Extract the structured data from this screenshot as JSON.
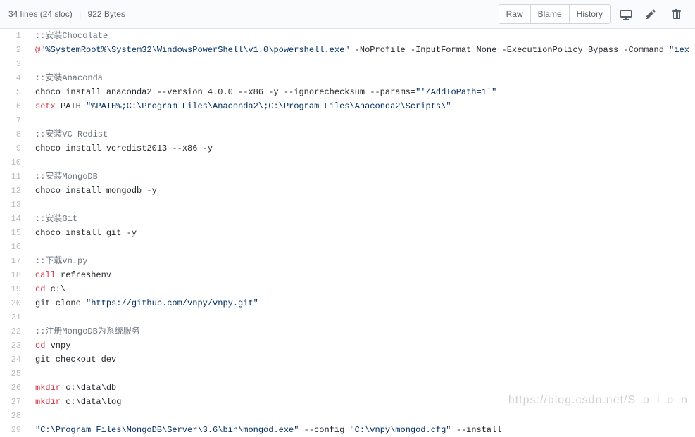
{
  "header": {
    "lines": "34 lines (24 sloc)",
    "size": "922 Bytes",
    "buttons": {
      "raw": "Raw",
      "blame": "Blame",
      "history": "History"
    }
  },
  "watermark": "https://blog.csdn.net/S_o_l_o_n",
  "code": [
    {
      "n": 1,
      "segs": [
        {
          "t": "::安装Chocolate",
          "c": "c-comment"
        }
      ]
    },
    {
      "n": 2,
      "segs": [
        {
          "t": "@",
          "c": "c-red"
        },
        {
          "t": "\"%SystemRoot%\\System32\\WindowsPowerShell\\v1.0\\powershell.exe\"",
          "c": "c-str"
        },
        {
          "t": " -NoProfile -InputFormat None -ExecutionPolicy Bypass -Command "
        },
        {
          "t": "\"iex ((New-Obj",
          "c": "c-str"
        }
      ]
    },
    {
      "n": 3,
      "segs": []
    },
    {
      "n": 4,
      "segs": [
        {
          "t": "::安装Anaconda",
          "c": "c-comment"
        }
      ]
    },
    {
      "n": 5,
      "segs": [
        {
          "t": "choco install anaconda2 --version 4.0.0 --x86 -y --ignorechecksum --params="
        },
        {
          "t": "\"'/AddToPath=1'\"",
          "c": "c-str"
        }
      ]
    },
    {
      "n": 6,
      "segs": [
        {
          "t": "setx",
          "c": "c-red"
        },
        {
          "t": " PATH "
        },
        {
          "t": "\"%PATH%;C:\\Program Files\\Anaconda2\\;C:\\Program Files\\Anaconda2\\Scripts\\\"",
          "c": "c-str"
        }
      ]
    },
    {
      "n": 7,
      "segs": []
    },
    {
      "n": 8,
      "segs": [
        {
          "t": "::安装VC Redist",
          "c": "c-comment"
        }
      ]
    },
    {
      "n": 9,
      "segs": [
        {
          "t": "choco install vcredist2013 --x86 -y"
        }
      ]
    },
    {
      "n": 10,
      "segs": []
    },
    {
      "n": 11,
      "segs": [
        {
          "t": "::安装MongoDB",
          "c": "c-comment"
        }
      ]
    },
    {
      "n": 12,
      "segs": [
        {
          "t": "choco install mongodb -y"
        }
      ]
    },
    {
      "n": 13,
      "segs": []
    },
    {
      "n": 14,
      "segs": [
        {
          "t": "::安装Git",
          "c": "c-comment"
        }
      ]
    },
    {
      "n": 15,
      "segs": [
        {
          "t": "choco install git -y"
        }
      ]
    },
    {
      "n": 16,
      "segs": []
    },
    {
      "n": 17,
      "segs": [
        {
          "t": "::下载vn.py",
          "c": "c-comment"
        }
      ]
    },
    {
      "n": 18,
      "segs": [
        {
          "t": "call",
          "c": "c-red"
        },
        {
          "t": " refreshenv"
        }
      ]
    },
    {
      "n": 19,
      "segs": [
        {
          "t": "cd",
          "c": "c-red"
        },
        {
          "t": " c:\\"
        }
      ]
    },
    {
      "n": 20,
      "segs": [
        {
          "t": "git clone "
        },
        {
          "t": "\"https://github.com/vnpy/vnpy.git\"",
          "c": "c-str"
        }
      ]
    },
    {
      "n": 21,
      "segs": []
    },
    {
      "n": 22,
      "segs": [
        {
          "t": "::注册MongoDB为系统服务",
          "c": "c-comment"
        }
      ]
    },
    {
      "n": 23,
      "segs": [
        {
          "t": "cd",
          "c": "c-red"
        },
        {
          "t": " vnpy"
        }
      ]
    },
    {
      "n": 24,
      "segs": [
        {
          "t": "git checkout dev"
        }
      ]
    },
    {
      "n": 25,
      "segs": []
    },
    {
      "n": 26,
      "segs": [
        {
          "t": "mkdir",
          "c": "c-red"
        },
        {
          "t": " c:\\data\\db"
        }
      ]
    },
    {
      "n": 27,
      "segs": [
        {
          "t": "mkdir",
          "c": "c-red"
        },
        {
          "t": " c:\\data\\log"
        }
      ]
    },
    {
      "n": 28,
      "segs": []
    },
    {
      "n": 29,
      "segs": [
        {
          "t": "\"C:\\Program Files\\MongoDB\\Server\\3.6\\bin\\mongod.exe\"",
          "c": "c-str"
        },
        {
          "t": " --config "
        },
        {
          "t": "\"C:\\vnpy\\mongod.cfg\"",
          "c": "c-str"
        },
        {
          "t": " --install"
        }
      ]
    }
  ]
}
